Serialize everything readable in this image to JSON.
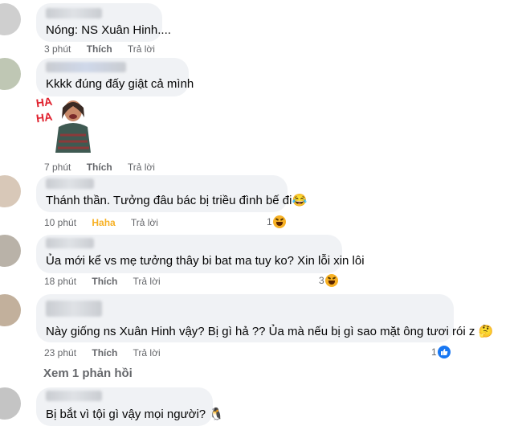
{
  "comments": [
    {
      "text": "Nóng: NS Xuân Hinh....",
      "time": "3 phút",
      "like": "Thích",
      "reply": "Trả lời"
    },
    {
      "text": "Kkkk đúng đấy giật cả mình",
      "time": "7 phút",
      "like": "Thích",
      "reply": "Trả lời",
      "sticker_text": "HA HA"
    },
    {
      "text": "Thánh thần. Tưởng đâu bác bị triều đình bế đi😂",
      "time": "10 phút",
      "like": "Haha",
      "reply": "Trả lời",
      "reaction_count": "1",
      "reaction_icon": "haha-icon"
    },
    {
      "text": "Ủa mới kể vs mẹ tưởng thây bi bat ma tuy ko? Xin lỗi xin lôi",
      "time": "18 phút",
      "like": "Thích",
      "reply": "Trả lời",
      "reaction_count": "3",
      "reaction_icon": "haha-icon"
    },
    {
      "text": "Này giống ns Xuân Hinh vậy? Bị gì hả ?? Ủa mà nếu bị gì sao mặt ông tươi rói z 🤔",
      "time": "23 phút",
      "like": "Thích",
      "reply": "Trả lời",
      "reaction_count": "1",
      "reaction_icon": "like-icon"
    },
    {
      "text": "Bị bắt vì tội gì vậy mọi người? 🐧"
    }
  ],
  "view_replies": "Xem 1 phản hồi",
  "colors": {
    "bubble": "#f0f2f5",
    "meta": "#65676b",
    "haha": "#f7b125",
    "like": "#1877f2"
  }
}
